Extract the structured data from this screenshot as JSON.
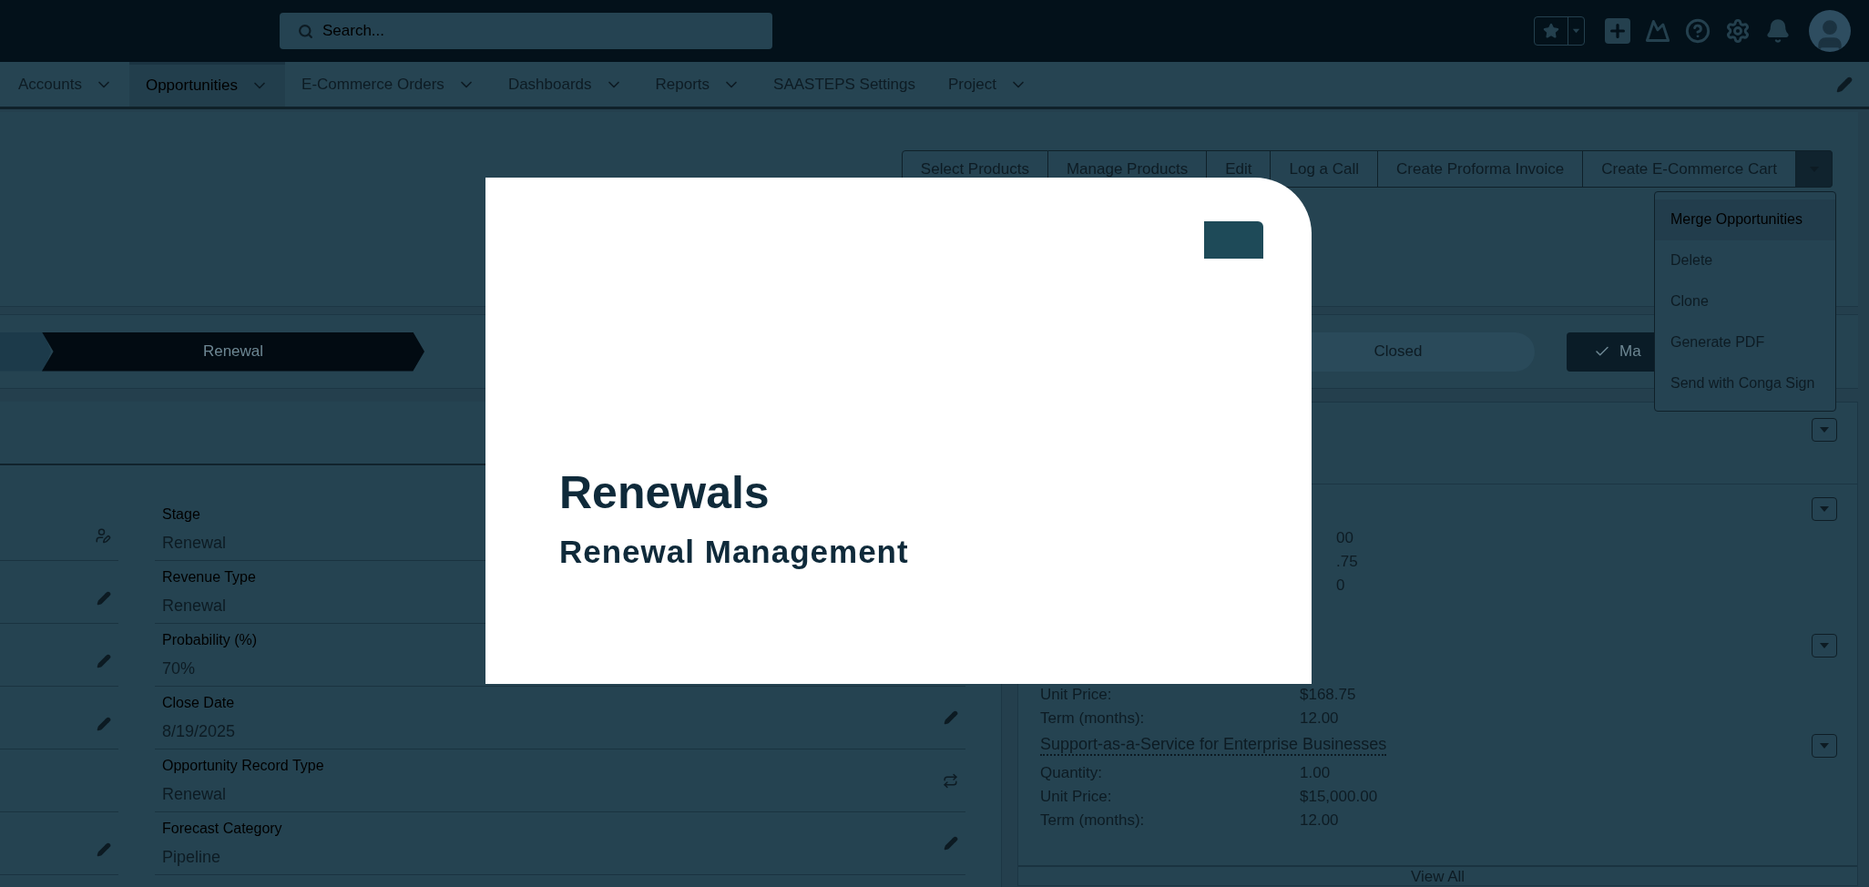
{
  "top_bar": {
    "search": {
      "placeholder": "Search..."
    }
  },
  "nav": {
    "tabs": [
      {
        "label": "Accounts",
        "selected": false,
        "has_menu": true
      },
      {
        "label": "Opportunities",
        "selected": true,
        "has_menu": true
      },
      {
        "label": "E-Commerce Orders",
        "selected": false,
        "has_menu": true
      },
      {
        "label": "Dashboards",
        "selected": false,
        "has_menu": true
      },
      {
        "label": "Reports",
        "selected": false,
        "has_menu": true
      },
      {
        "label": "SAASTEPS Settings",
        "selected": false,
        "has_menu": false
      },
      {
        "label": "Project",
        "selected": false,
        "has_menu": true
      }
    ]
  },
  "actions": {
    "buttons": [
      "Select Products",
      "Manage Products",
      "Edit",
      "Log a Call",
      "Create Proforma Invoice",
      "Create E-Commerce Cart"
    ],
    "menu": {
      "expanded": true,
      "items": [
        {
          "label": "Merge Opportunities",
          "selected": true
        },
        {
          "label": "Delete",
          "selected": false
        },
        {
          "label": "Clone",
          "selected": false
        },
        {
          "label": "Generate PDF",
          "selected": false
        },
        {
          "label": "Send with Conga Sign",
          "selected": false
        }
      ]
    }
  },
  "path": {
    "steps": [
      {
        "label": "Renewal",
        "selected": true
      },
      {
        "label": "Closed",
        "selected": false
      }
    ],
    "mark_button": "Ma"
  },
  "details": {
    "left_column": [
      {
        "kind": "owner"
      },
      {
        "kind": "edit"
      },
      {
        "kind": "edit"
      },
      {
        "kind": "edit"
      },
      {
        "kind": "none"
      },
      {
        "kind": "edit"
      }
    ],
    "fields": [
      {
        "label": "Stage",
        "value": "Renewal",
        "kind": "none"
      },
      {
        "label": "Revenue Type",
        "value": "Renewal",
        "kind": "none"
      },
      {
        "label": "Probability (%)",
        "value": "70%",
        "kind": "none"
      },
      {
        "label": "Close Date",
        "value": "8/19/2025",
        "kind": "edit"
      },
      {
        "label": "Opportunity Record Type",
        "value": "Renewal",
        "kind": "swap"
      },
      {
        "label": "Forecast Category",
        "value": "Pipeline",
        "kind": "edit"
      }
    ]
  },
  "products": {
    "items": [
      {
        "rows": [
          {
            "value": "00"
          },
          {
            "value": ".75"
          },
          {
            "value": "0"
          }
        ]
      },
      {
        "rows": [
          {
            "label": "Unit Price:",
            "value": "$168.75"
          },
          {
            "label": "Term (months):",
            "value": "12.00"
          }
        ]
      },
      {
        "name": "Support-as-a-Service for Enterprise Businesses",
        "rows": [
          {
            "label": "Quantity:",
            "value": "1.00"
          },
          {
            "label": "Unit Price:",
            "value": "$15,000.00"
          },
          {
            "label": "Term (months):",
            "value": "12.00"
          }
        ]
      }
    ],
    "view_all": "View All"
  },
  "modal": {
    "title": "Renewals",
    "subtitle": "Renewal Management"
  }
}
